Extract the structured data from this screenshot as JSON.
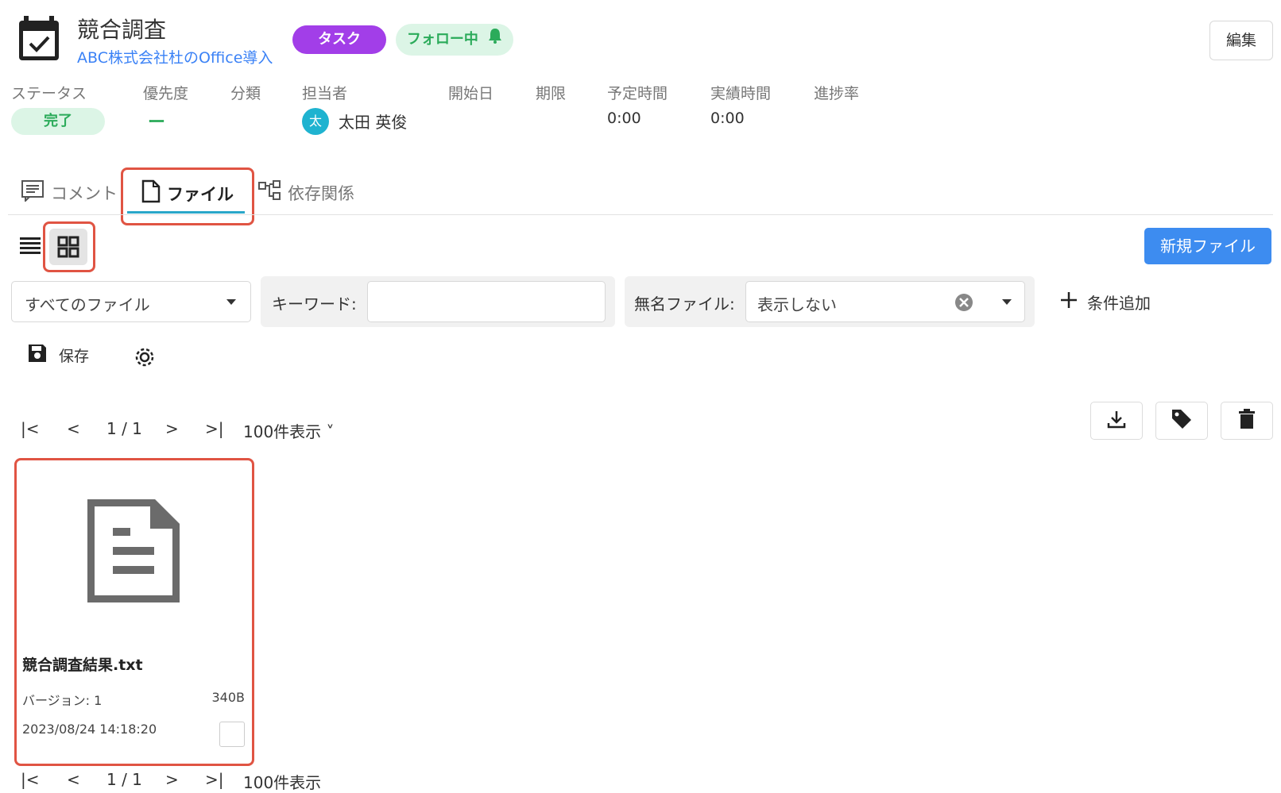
{
  "header": {
    "title": "競合調査",
    "subtitle": "ABC株式会社杜のOffice導入",
    "task_badge": "タスク",
    "follow_badge": "フォロー中",
    "edit_label": "編集"
  },
  "meta": {
    "labels": [
      "ステータス",
      "優先度",
      "分類",
      "担当者",
      "開始日",
      "期限",
      "予定時間",
      "実績時間",
      "進捗率"
    ],
    "status": "完了",
    "priority": "ー",
    "assignee_initial": "太",
    "assignee": "太田 英俊",
    "planned_time": "0:00",
    "actual_time": "0:00"
  },
  "tabs": [
    {
      "label": "コメント",
      "icon": "comment-icon"
    },
    {
      "label": "ファイル",
      "icon": "file-icon",
      "active": true
    },
    {
      "label": "依存関係",
      "icon": "dependency-icon"
    }
  ],
  "toolbar": {
    "new_file_label": "新規ファイル",
    "file_filter_value": "すべてのファイル",
    "keyword_label": "キーワード:",
    "keyword_value": "",
    "unnamed_label": "無名ファイル:",
    "unnamed_value": "表示しない",
    "add_condition_label": "条件追加",
    "save_label": "保存"
  },
  "pager": {
    "page": "1 / 1",
    "per_page": "100件表示"
  },
  "files": [
    {
      "name": "競合調査結果.txt",
      "version": "バージョン: 1",
      "size": "340B",
      "date": "2023/08/24 14:18:20"
    }
  ],
  "colors": {
    "accent": "#3d8cf0",
    "task": "#a23ee8",
    "success": "#2bab5a",
    "highlight": "#e05443"
  }
}
